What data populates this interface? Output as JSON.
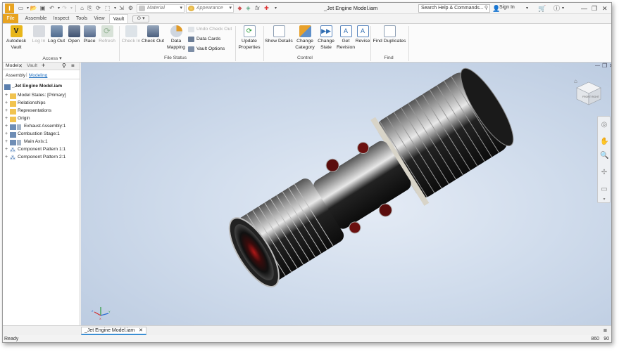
{
  "app": {
    "logo_letter": "I",
    "logo_color": "#e8a320"
  },
  "quick_access": {
    "icons": [
      "new-icon",
      "dropdown-icon",
      "open-icon",
      "save-icon",
      "undo-icon",
      "redo-icon",
      "home-icon",
      "update-icon",
      "select-icon",
      "measure-icon"
    ],
    "material_placeholder": "Material",
    "appearance_placeholder": "Appearance"
  },
  "title": "_Jet Engine Model.iam",
  "search": {
    "placeholder": "Search Help & Commands..."
  },
  "account": {
    "signin_label": "Sign In"
  },
  "tabs": [
    "File",
    "Assemble",
    "Inspect",
    "Tools",
    "View",
    "Vault"
  ],
  "active_tab": "Vault",
  "ribbon": {
    "access": {
      "label": "Access",
      "buttons": [
        {
          "label1": "Autodesk",
          "label2": "Vault",
          "enabled": true
        },
        {
          "label1": "Log In",
          "label2": "",
          "enabled": false
        },
        {
          "label1": "Log Out",
          "label2": "",
          "enabled": true
        },
        {
          "label1": "Open",
          "label2": "",
          "enabled": true
        },
        {
          "label1": "Place",
          "label2": "",
          "enabled": true
        },
        {
          "label1": "Refresh",
          "label2": "",
          "enabled": false
        }
      ]
    },
    "file_status": {
      "label": "File Status",
      "check_in": "Check In",
      "check_out": "Check Out",
      "data_mapping1": "Data",
      "data_mapping2": "Mapping",
      "undo_check_out": "Undo Check Out",
      "data_cards": "Data Cards",
      "vault_options": "Vault Options"
    },
    "update_props1": "Update",
    "update_props2": "Properties",
    "control": {
      "label": "Control",
      "show_details": "Show Details",
      "change_category1": "Change",
      "change_category2": "Category",
      "change_state1": "Change",
      "change_state2": "State",
      "get_revision1": "Get",
      "get_revision2": "Revision",
      "revise": "Revise"
    },
    "find": {
      "label": "Find",
      "find_duplicates": "Find Duplicates"
    }
  },
  "browser": {
    "tab_model": "Model",
    "tab_vault": "Vault",
    "subtab_assembly": "Assembly",
    "subtab_modeling": "Modeling",
    "root": "_Jet Engine Model.iam",
    "nodes": [
      "Model States: [Primary]",
      "Relationships",
      "Representations",
      "Origin",
      "Exhaust Assembly:1",
      "Combustion Stage:1",
      "Main Axis:1",
      "Component Pattern 1:1",
      "Component Pattern 2:1"
    ]
  },
  "viewcube": {
    "front": "FRONT",
    "right": "RIGHT"
  },
  "triad": {
    "x": "X",
    "y": "Y",
    "z": "Z"
  },
  "doc_tab": {
    "label": "_Jet Engine Model.iam"
  },
  "status": {
    "text": "Ready",
    "count1": "860",
    "count2": "90"
  }
}
